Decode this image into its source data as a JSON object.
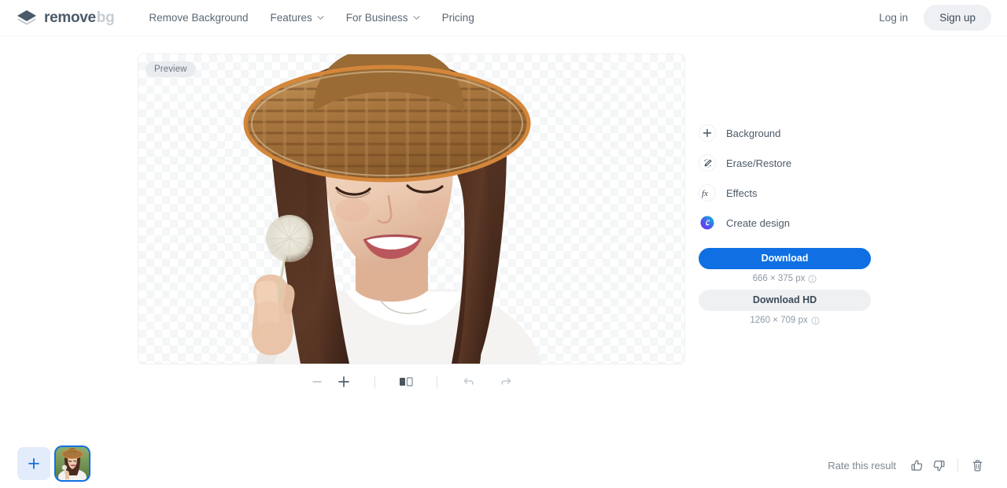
{
  "header": {
    "logo": {
      "icon": "layers-icon",
      "text_primary": "remove",
      "text_secondary": "bg"
    },
    "nav": [
      {
        "label": "Remove Background",
        "has_caret": false,
        "name": "nav-remove-background"
      },
      {
        "label": "Features",
        "has_caret": true,
        "name": "nav-features"
      },
      {
        "label": "For Business",
        "has_caret": true,
        "name": "nav-for-business"
      },
      {
        "label": "Pricing",
        "has_caret": false,
        "name": "nav-pricing"
      }
    ],
    "login_label": "Log in",
    "signup_label": "Sign up"
  },
  "canvas": {
    "preview_badge": "Preview",
    "transparency_pattern": "checkerboard",
    "subject_description": "woman with straw hat holding a dandelion"
  },
  "image_toolbar": {
    "zoom_out": {
      "label": "−",
      "name": "zoom-out-button"
    },
    "zoom_in": {
      "label": "+",
      "name": "zoom-in-button"
    },
    "compare": {
      "name": "compare-split-icon"
    },
    "undo": {
      "name": "undo-icon"
    },
    "redo": {
      "name": "redo-icon"
    }
  },
  "panel": {
    "items": [
      {
        "label": "Background",
        "icon": "plus-icon"
      },
      {
        "label": "Erase/Restore",
        "icon": "magic-brush-icon"
      },
      {
        "label": "Effects",
        "icon": "fx-icon"
      },
      {
        "label": "Create design",
        "icon": "canva-icon"
      }
    ],
    "download": {
      "primary_label": "Download",
      "primary_size": "666 × 375 px",
      "secondary_label": "Download HD",
      "secondary_size": "1260 × 709 px",
      "info_icon": "info-icon"
    }
  },
  "footer": {
    "add_image": {
      "icon": "plus-icon",
      "name": "add-image-button"
    },
    "thumbnail_selected": true,
    "rate_label": "Rate this result",
    "thumbs_up_icon": "thumbs-up-icon",
    "thumbs_down_icon": "thumbs-down-icon",
    "delete_icon": "trash-icon"
  },
  "colors": {
    "accent_blue": "#1070e3",
    "text_dark": "#3d4b59",
    "text_muted": "#8e99a4",
    "chip_gray": "#eef0f2"
  }
}
